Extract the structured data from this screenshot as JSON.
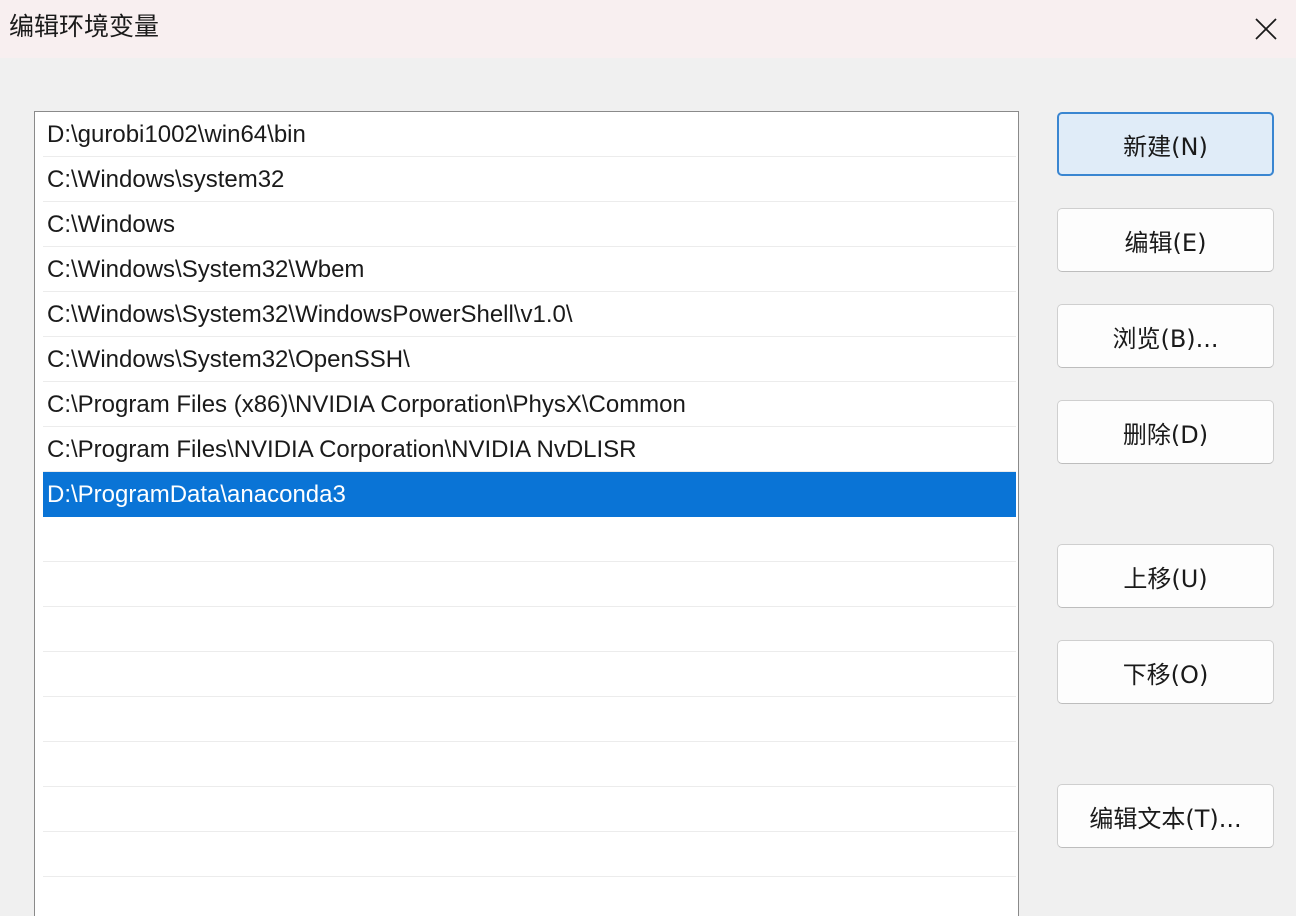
{
  "window": {
    "title": "编辑环境变量"
  },
  "paths": [
    "D:\\gurobi1002\\win64\\bin",
    "C:\\Windows\\system32",
    "C:\\Windows",
    "C:\\Windows\\System32\\Wbem",
    "C:\\Windows\\System32\\WindowsPowerShell\\v1.0\\",
    "C:\\Windows\\System32\\OpenSSH\\",
    "C:\\Program Files (x86)\\NVIDIA Corporation\\PhysX\\Common",
    "C:\\Program Files\\NVIDIA Corporation\\NVIDIA NvDLISR",
    "D:\\ProgramData\\anaconda3",
    "",
    "",
    "",
    "",
    "",
    "",
    "",
    "",
    ""
  ],
  "selected_index": 8,
  "buttons": {
    "new": "新建(N)",
    "edit": "编辑(E)",
    "browse": "浏览(B)...",
    "delete": "删除(D)",
    "move_up": "上移(U)",
    "move_down": "下移(O)",
    "edit_text": "编辑文本(T)..."
  },
  "colors": {
    "selection": "#0a74d6",
    "default_button_border": "#3a86d1"
  },
  "icons": {
    "close": "close-icon"
  }
}
